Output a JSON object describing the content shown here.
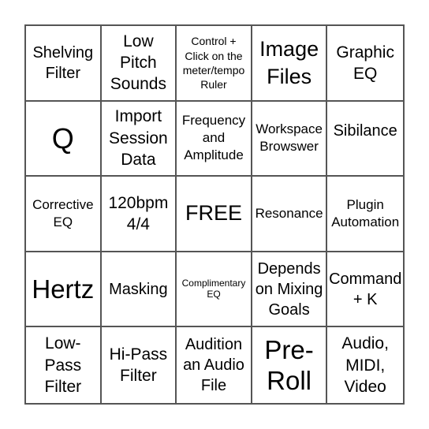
{
  "board": {
    "cells": [
      [
        "Shelving Filter",
        "Low Pitch Sounds",
        "Control + Click on the meter/tempo Ruler",
        "Image Files",
        "Graphic EQ"
      ],
      [
        "Q",
        "Import Session Data",
        "Frequency and Amplitude",
        "Workspace Browswer",
        "Sibilance"
      ],
      [
        "Corrective EQ",
        "120bpm 4/4",
        "FREE",
        "Resonance",
        "Plugin Automation"
      ],
      [
        "Hertz",
        "Masking",
        "Complimentary EQ",
        "Depends on Mixing Goals",
        "Command + K"
      ],
      [
        "Low-Pass Filter",
        "Hi-Pass Filter",
        "Audition an Audio File",
        "Pre-Roll",
        "Audio, MIDI, Video"
      ]
    ],
    "free_space": "FREE",
    "line_color": "#555555"
  }
}
